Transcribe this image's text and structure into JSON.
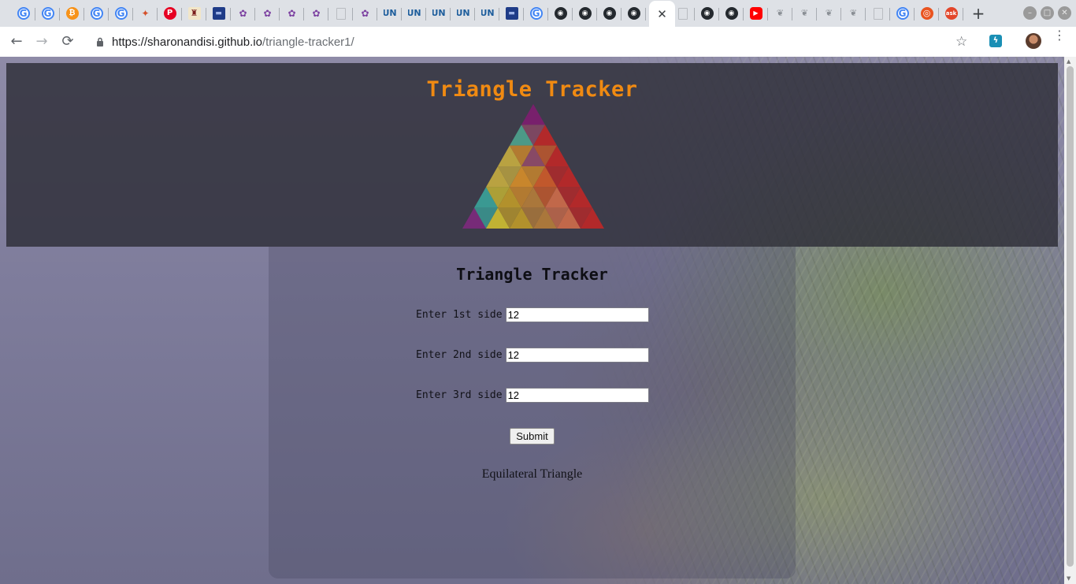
{
  "browser": {
    "tabs": [
      {
        "icon": "google-icon",
        "glyph": "G",
        "kind": "g"
      },
      {
        "icon": "google-icon",
        "glyph": "G",
        "kind": "g"
      },
      {
        "icon": "bitcoin-icon",
        "glyph": "₿",
        "kind": "btc"
      },
      {
        "icon": "google-icon",
        "glyph": "G",
        "kind": "g"
      },
      {
        "icon": "google-icon",
        "glyph": "G",
        "kind": "g"
      },
      {
        "icon": "colorful-bird-icon",
        "glyph": "✦",
        "kind": "bird"
      },
      {
        "icon": "pinterest-icon",
        "glyph": "P",
        "kind": "pin"
      },
      {
        "icon": "university-crest-icon",
        "glyph": "♜",
        "kind": "crest"
      },
      {
        "icon": "blue-card-icon",
        "glyph": "▬",
        "kind": "card"
      },
      {
        "icon": "vine-icon",
        "glyph": "✿",
        "kind": "vine"
      },
      {
        "icon": "vine-icon",
        "glyph": "✿",
        "kind": "vine"
      },
      {
        "icon": "vine-icon",
        "glyph": "✿",
        "kind": "vine"
      },
      {
        "icon": "vine-icon",
        "glyph": "✿",
        "kind": "vine"
      },
      {
        "icon": "blank-page-icon",
        "glyph": "",
        "kind": "blank"
      },
      {
        "icon": "vine-icon",
        "glyph": "✿",
        "kind": "vine"
      },
      {
        "icon": "un-icon",
        "glyph": "UN",
        "kind": "un"
      },
      {
        "icon": "un-icon",
        "glyph": "UN",
        "kind": "un"
      },
      {
        "icon": "un-icon",
        "glyph": "UN",
        "kind": "un"
      },
      {
        "icon": "un-icon",
        "glyph": "UN",
        "kind": "un"
      },
      {
        "icon": "un-icon",
        "glyph": "UN",
        "kind": "un"
      },
      {
        "icon": "blue-card-icon",
        "glyph": "▬",
        "kind": "card"
      },
      {
        "icon": "google-icon",
        "glyph": "G",
        "kind": "g"
      },
      {
        "icon": "github-icon",
        "glyph": "◉",
        "kind": "gh"
      },
      {
        "icon": "github-icon",
        "glyph": "◉",
        "kind": "gh"
      },
      {
        "icon": "github-icon",
        "glyph": "◉",
        "kind": "gh"
      },
      {
        "icon": "github-icon",
        "glyph": "◉",
        "kind": "gh"
      },
      {
        "icon": "close-icon",
        "glyph": "✕",
        "kind": "active"
      },
      {
        "icon": "blank-page-icon",
        "glyph": "",
        "kind": "blank"
      },
      {
        "icon": "github-icon",
        "glyph": "◉",
        "kind": "gh"
      },
      {
        "icon": "github-icon",
        "glyph": "◉",
        "kind": "gh"
      },
      {
        "icon": "youtube-icon",
        "glyph": "▶",
        "kind": "yt"
      },
      {
        "icon": "faded-leaf-icon",
        "glyph": "❦",
        "kind": "ghost"
      },
      {
        "icon": "faded-leaf-icon",
        "glyph": "❦",
        "kind": "ghost"
      },
      {
        "icon": "faded-leaf-icon",
        "glyph": "❦",
        "kind": "ghost"
      },
      {
        "icon": "faded-leaf-icon",
        "glyph": "❦",
        "kind": "ghost"
      },
      {
        "icon": "blank-page-icon",
        "glyph": "",
        "kind": "blank"
      },
      {
        "icon": "google-icon",
        "glyph": "G",
        "kind": "g"
      },
      {
        "icon": "ubuntu-icon",
        "glyph": "◎",
        "kind": "ubuntu"
      },
      {
        "icon": "ask-icon",
        "glyph": "ask",
        "kind": "ask"
      }
    ],
    "new_tab_label": "+",
    "window_buttons": [
      "–",
      "□",
      "✕"
    ],
    "url_host": "https://sharonandisi.github.io",
    "url_path": "/triangle-tracker1/",
    "nav": {
      "back": "←",
      "forward": "→",
      "reload": "⟳"
    },
    "star": "☆",
    "extension_label": "ϟ",
    "menu": "⋮"
  },
  "page": {
    "header_title": "Triangle Tracker",
    "form_title": "Triangle Tracker",
    "fields": [
      {
        "label": "Enter 1st side",
        "value": "12"
      },
      {
        "label": "Enter 2nd side",
        "value": "12"
      },
      {
        "label": "Enter 3rd side",
        "value": "12"
      }
    ],
    "submit_label": "Submit",
    "result_text": "Equilateral Triangle"
  },
  "colors": {
    "header_title": "#f08a12",
    "header_bg": "#2d2d37",
    "logo_palette": [
      "#7b1f6e",
      "#8c4a66",
      "#4d9e8a",
      "#c0a840",
      "#d08a2a",
      "#c85a2a",
      "#b82828",
      "#3a9e96",
      "#c8b832",
      "#b8962a",
      "#b07a3a",
      "#c86a4a",
      "#7a2a7a"
    ]
  }
}
